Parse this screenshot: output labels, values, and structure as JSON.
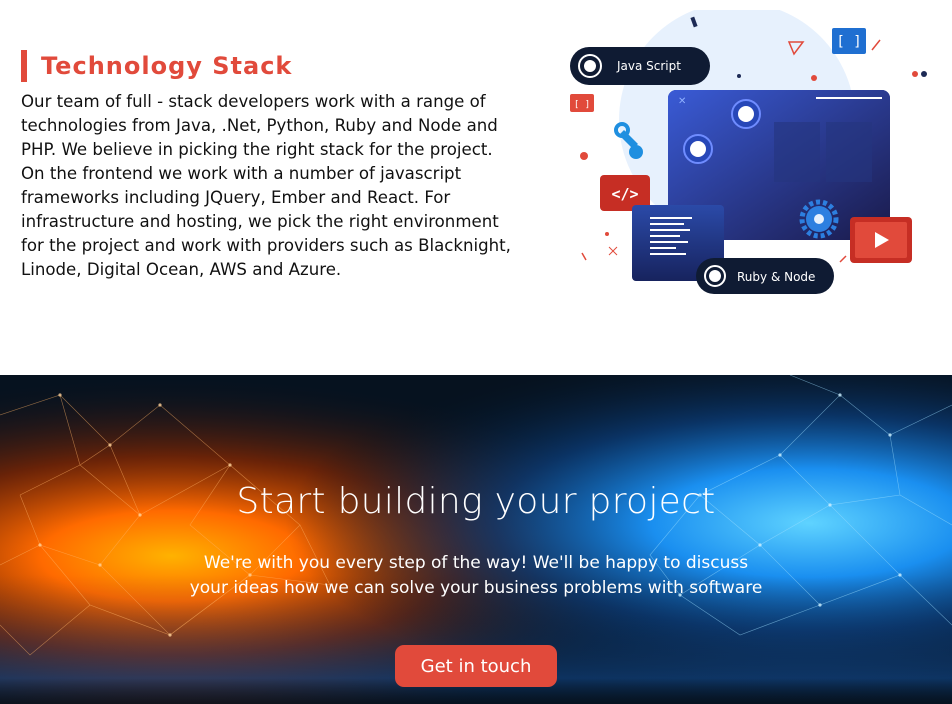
{
  "tech_stack": {
    "heading": "Technology Stack",
    "body": "Our team of full - stack developers work with a range of technologies from Java, .Net, Python, Ruby and Node and PHP. We believe in picking the right stack for the project. On the frontend we work with a number of javascript frameworks including JQuery, Ember and React. For infrastructure and hosting, we pick the right environment for the project and work with providers such as Blacknight, Linode, Digital Ocean, AWS and Azure.",
    "illustration": {
      "badge_top": "Java Script",
      "badge_bottom": "Ruby & Node",
      "code_symbol": "</>",
      "bracket_symbol": "[ ]"
    }
  },
  "cta": {
    "title": "Start building your project",
    "subtitle_line1": "We're with you every step of the way! We'll be happy to discuss",
    "subtitle_line2": "your ideas how we can solve your business problems with software",
    "button_label": "Get in touch"
  },
  "colors": {
    "accent": "#e14a3b",
    "dark_navy": "#0f1b33",
    "cta_orange": "#ff6a00",
    "cta_blue": "#1aa3ff"
  }
}
